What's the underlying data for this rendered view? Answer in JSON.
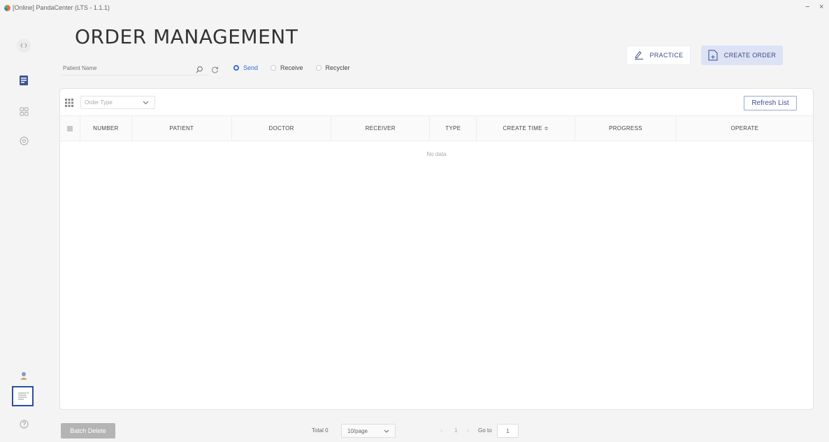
{
  "window": {
    "title": "[Online] PandaCenter (LTS - 1.1.1)",
    "minimize": "−",
    "close": "×"
  },
  "page": {
    "title": "ORDER MANAGEMENT"
  },
  "search": {
    "placeholder": "Patient Name"
  },
  "filters": {
    "options": [
      "Send",
      "Receive",
      "Recycler"
    ],
    "selected": "Send"
  },
  "actions": {
    "practice": "PRACTICE",
    "create_order": "CREATE ORDER"
  },
  "table": {
    "order_type_placeholder": "Order Type",
    "refresh": "Refresh List",
    "columns": [
      "NUMBER",
      "PATIENT",
      "DOCTOR",
      "RECEIVER",
      "TYPE",
      "CREATE TIME ≑",
      "PROGRESS",
      "OPERATE"
    ],
    "empty_text": "No data"
  },
  "footer": {
    "batch_delete": "Batch Delete",
    "total": "Total 0",
    "page_size": "10/page",
    "current_page": "1",
    "goto_label": "Go to",
    "goto_value": "1"
  },
  "colors": {
    "accent": "#3a6ad8",
    "create_btn_bg": "#dde3f5",
    "panel_bg": "#ffffff",
    "app_bg": "#f4f4f4"
  },
  "icons": [
    "expand-icon",
    "orders-icon",
    "grid-icon",
    "target-icon",
    "user-icon",
    "notes-icon",
    "help-icon",
    "search-icon",
    "reset-icon",
    "pen-icon",
    "add-file-icon",
    "columns-grid-icon",
    "chevron-down-icon"
  ]
}
